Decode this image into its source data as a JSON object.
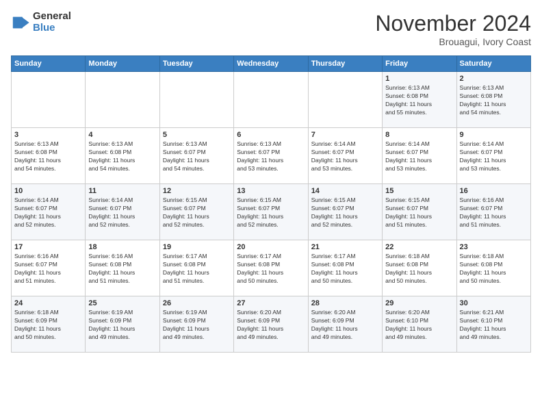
{
  "header": {
    "logo_general": "General",
    "logo_blue": "Blue",
    "month_title": "November 2024",
    "location": "Brouagui, Ivory Coast"
  },
  "calendar": {
    "days_of_week": [
      "Sunday",
      "Monday",
      "Tuesday",
      "Wednesday",
      "Thursday",
      "Friday",
      "Saturday"
    ],
    "weeks": [
      [
        {
          "day": "",
          "info": ""
        },
        {
          "day": "",
          "info": ""
        },
        {
          "day": "",
          "info": ""
        },
        {
          "day": "",
          "info": ""
        },
        {
          "day": "",
          "info": ""
        },
        {
          "day": "1",
          "info": "Sunrise: 6:13 AM\nSunset: 6:08 PM\nDaylight: 11 hours\nand 55 minutes."
        },
        {
          "day": "2",
          "info": "Sunrise: 6:13 AM\nSunset: 6:08 PM\nDaylight: 11 hours\nand 54 minutes."
        }
      ],
      [
        {
          "day": "3",
          "info": "Sunrise: 6:13 AM\nSunset: 6:08 PM\nDaylight: 11 hours\nand 54 minutes."
        },
        {
          "day": "4",
          "info": "Sunrise: 6:13 AM\nSunset: 6:08 PM\nDaylight: 11 hours\nand 54 minutes."
        },
        {
          "day": "5",
          "info": "Sunrise: 6:13 AM\nSunset: 6:07 PM\nDaylight: 11 hours\nand 54 minutes."
        },
        {
          "day": "6",
          "info": "Sunrise: 6:13 AM\nSunset: 6:07 PM\nDaylight: 11 hours\nand 53 minutes."
        },
        {
          "day": "7",
          "info": "Sunrise: 6:14 AM\nSunset: 6:07 PM\nDaylight: 11 hours\nand 53 minutes."
        },
        {
          "day": "8",
          "info": "Sunrise: 6:14 AM\nSunset: 6:07 PM\nDaylight: 11 hours\nand 53 minutes."
        },
        {
          "day": "9",
          "info": "Sunrise: 6:14 AM\nSunset: 6:07 PM\nDaylight: 11 hours\nand 53 minutes."
        }
      ],
      [
        {
          "day": "10",
          "info": "Sunrise: 6:14 AM\nSunset: 6:07 PM\nDaylight: 11 hours\nand 52 minutes."
        },
        {
          "day": "11",
          "info": "Sunrise: 6:14 AM\nSunset: 6:07 PM\nDaylight: 11 hours\nand 52 minutes."
        },
        {
          "day": "12",
          "info": "Sunrise: 6:15 AM\nSunset: 6:07 PM\nDaylight: 11 hours\nand 52 minutes."
        },
        {
          "day": "13",
          "info": "Sunrise: 6:15 AM\nSunset: 6:07 PM\nDaylight: 11 hours\nand 52 minutes."
        },
        {
          "day": "14",
          "info": "Sunrise: 6:15 AM\nSunset: 6:07 PM\nDaylight: 11 hours\nand 52 minutes."
        },
        {
          "day": "15",
          "info": "Sunrise: 6:15 AM\nSunset: 6:07 PM\nDaylight: 11 hours\nand 51 minutes."
        },
        {
          "day": "16",
          "info": "Sunrise: 6:16 AM\nSunset: 6:07 PM\nDaylight: 11 hours\nand 51 minutes."
        }
      ],
      [
        {
          "day": "17",
          "info": "Sunrise: 6:16 AM\nSunset: 6:07 PM\nDaylight: 11 hours\nand 51 minutes."
        },
        {
          "day": "18",
          "info": "Sunrise: 6:16 AM\nSunset: 6:08 PM\nDaylight: 11 hours\nand 51 minutes."
        },
        {
          "day": "19",
          "info": "Sunrise: 6:17 AM\nSunset: 6:08 PM\nDaylight: 11 hours\nand 51 minutes."
        },
        {
          "day": "20",
          "info": "Sunrise: 6:17 AM\nSunset: 6:08 PM\nDaylight: 11 hours\nand 50 minutes."
        },
        {
          "day": "21",
          "info": "Sunrise: 6:17 AM\nSunset: 6:08 PM\nDaylight: 11 hours\nand 50 minutes."
        },
        {
          "day": "22",
          "info": "Sunrise: 6:18 AM\nSunset: 6:08 PM\nDaylight: 11 hours\nand 50 minutes."
        },
        {
          "day": "23",
          "info": "Sunrise: 6:18 AM\nSunset: 6:08 PM\nDaylight: 11 hours\nand 50 minutes."
        }
      ],
      [
        {
          "day": "24",
          "info": "Sunrise: 6:18 AM\nSunset: 6:09 PM\nDaylight: 11 hours\nand 50 minutes."
        },
        {
          "day": "25",
          "info": "Sunrise: 6:19 AM\nSunset: 6:09 PM\nDaylight: 11 hours\nand 49 minutes."
        },
        {
          "day": "26",
          "info": "Sunrise: 6:19 AM\nSunset: 6:09 PM\nDaylight: 11 hours\nand 49 minutes."
        },
        {
          "day": "27",
          "info": "Sunrise: 6:20 AM\nSunset: 6:09 PM\nDaylight: 11 hours\nand 49 minutes."
        },
        {
          "day": "28",
          "info": "Sunrise: 6:20 AM\nSunset: 6:09 PM\nDaylight: 11 hours\nand 49 minutes."
        },
        {
          "day": "29",
          "info": "Sunrise: 6:20 AM\nSunset: 6:10 PM\nDaylight: 11 hours\nand 49 minutes."
        },
        {
          "day": "30",
          "info": "Sunrise: 6:21 AM\nSunset: 6:10 PM\nDaylight: 11 hours\nand 49 minutes."
        }
      ]
    ]
  }
}
